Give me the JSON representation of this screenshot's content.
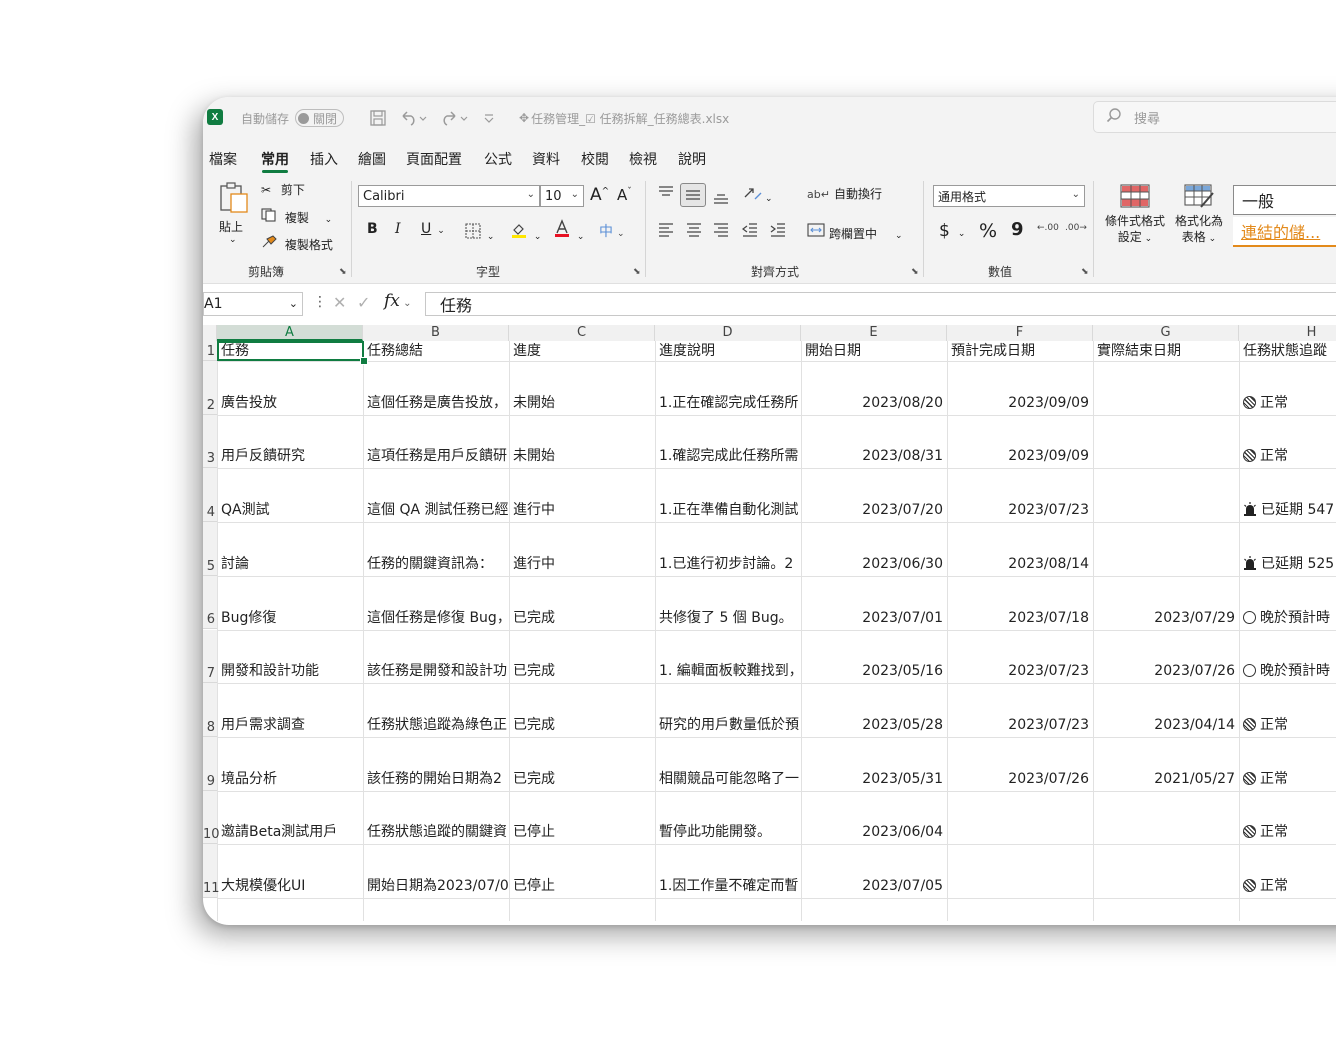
{
  "titlebar": {
    "autosave_label": "自動儲存",
    "autosave_state": "關閉",
    "file_name": "任務管理_☑ 任務拆解_任務總表.xlsx",
    "search_placeholder": "搜尋"
  },
  "menu": {
    "items": [
      "檔案",
      "常用",
      "插入",
      "繪圖",
      "頁面配置",
      "公式",
      "資料",
      "校閱",
      "檢視",
      "說明"
    ],
    "active": "常用"
  },
  "ribbon": {
    "clipboard": {
      "paste_label": "貼上",
      "cut_label": "剪下",
      "copy_label": "複製",
      "format_painter_label": "複製格式",
      "group_label": "剪貼簿"
    },
    "font": {
      "font_name": "Calibri",
      "font_size": "10",
      "bold": "B",
      "italic": "I",
      "underline": "U",
      "grow": "A",
      "shrink": "A",
      "phonetic": "中",
      "group_label": "字型"
    },
    "alignment": {
      "wrap_text_label": "自動換行",
      "merge_center_label": "跨欄置中",
      "group_label": "對齊方式"
    },
    "number": {
      "format_value": "通用格式",
      "currency": "$",
      "percent": "%",
      "comma": "9",
      "inc_decimal": ".00",
      "dec_decimal": ".00",
      "group_label": "數值"
    },
    "styles": {
      "conditional_label_1": "條件式格式",
      "conditional_label_2": "設定",
      "table_label_1": "格式化為",
      "table_label_2": "表格",
      "style_normal": "一般",
      "style_hyperlink": "連結的儲..."
    }
  },
  "formula_bar": {
    "name_box": "A1",
    "fx_label": "fx",
    "content": "任務"
  },
  "columns": [
    "A",
    "B",
    "C",
    "D",
    "E",
    "F",
    "G",
    "H"
  ],
  "header_row": {
    "row_num": "1",
    "cells": [
      "任務",
      "任務總結",
      "進度",
      "進度說明",
      "開始日期",
      "預計完成日期",
      "實際結束日期",
      "任務狀態追蹤"
    ]
  },
  "rows": [
    {
      "num": "2",
      "a": "廣告投放",
      "b": "這個任務是廣告投放，",
      "c": "未開始",
      "d": "1.正在確認完成任務所",
      "e": "2023/08/20",
      "f": "2023/09/09",
      "g": "",
      "h_icon": "normal",
      "h": "正常"
    },
    {
      "num": "3",
      "a": "用戶反饋研究",
      "b": "這項任務是用戶反饋研",
      "c": "未開始",
      "d": "1.確認完成此任務所需",
      "e": "2023/08/31",
      "f": "2023/09/09",
      "g": "",
      "h_icon": "normal",
      "h": "正常"
    },
    {
      "num": "4",
      "a": "QA測試",
      "b": "這個 QA 測試任務已經",
      "c": "進行中",
      "d": "1.正在準備自動化測試",
      "e": "2023/07/20",
      "f": "2023/07/23",
      "g": "",
      "h_icon": "delay",
      "h": "已延期 547"
    },
    {
      "num": "5",
      "a": "討論",
      "b": "任務的關鍵資訊為：",
      "c": "進行中",
      "d": "1.已進行初步討論。2",
      "e": "2023/06/30",
      "f": "2023/08/14",
      "g": "",
      "h_icon": "delay",
      "h": "已延期 525"
    },
    {
      "num": "6",
      "a": "Bug修復",
      "b": "這個任務是修復 Bug，",
      "c": "已完成",
      "d": "共修復了 5 個 Bug。",
      "e": "2023/07/01",
      "f": "2023/07/18",
      "g": "2023/07/29",
      "h_icon": "late",
      "h": "晚於預計時"
    },
    {
      "num": "7",
      "a": "開發和設計功能",
      "b": "該任務是開發和設計功",
      "c": "已完成",
      "d": "1. 編輯面板較難找到，",
      "e": "2023/05/16",
      "f": "2023/07/23",
      "g": "2023/07/26",
      "h_icon": "late",
      "h": "晚於預計時"
    },
    {
      "num": "8",
      "a": "用戶需求調查",
      "b": "任務狀態追蹤為綠色正",
      "c": "已完成",
      "d": "研究的用戶數量低於預",
      "e": "2023/05/28",
      "f": "2023/07/23",
      "g": "2023/04/14",
      "h_icon": "normal",
      "h": "正常"
    },
    {
      "num": "9",
      "a": "境品分析",
      "b": "該任務的開始日期為2",
      "c": "已完成",
      "d": "相關競品可能忽略了一",
      "e": "2023/05/31",
      "f": "2023/07/26",
      "g": "2021/05/27",
      "h_icon": "normal",
      "h": "正常"
    },
    {
      "num": "10",
      "a": "邀請Beta測試用戶",
      "b": "任務狀態追蹤的關鍵資",
      "c": "已停止",
      "d": "暫停此功能開發。",
      "e": "2023/06/04",
      "f": "",
      "g": "",
      "h_icon": "normal",
      "h": "正常"
    },
    {
      "num": "11",
      "a": "大規模優化UI",
      "b": "開始日期為2023/07/0",
      "c": "已停止",
      "d": "1.因工作量不確定而暫",
      "e": "2023/07/05",
      "f": "",
      "g": "",
      "h_icon": "normal",
      "h": "正常"
    }
  ],
  "colors": {
    "accent_green": "#107c41",
    "hyperlink_orange": "#e38a1b"
  }
}
